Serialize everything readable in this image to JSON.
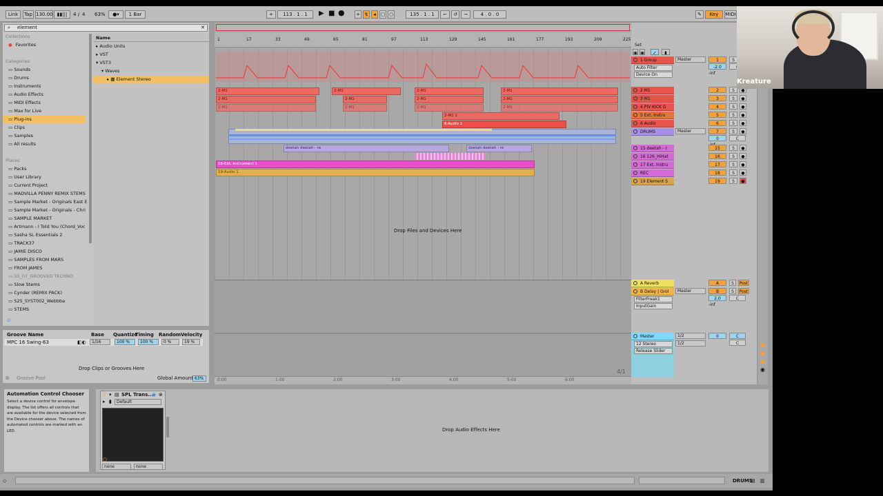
{
  "transport": {
    "link": "Link",
    "tap": "Tap",
    "tempo": "130.00",
    "metronome_icon": "bars-icon",
    "signature_num": "4",
    "signature_den": "4",
    "cpu": "63%",
    "bar_quant": "1 Bar",
    "position": "113 .   1 .   1",
    "loop_start": "135 .   1 .   1",
    "loop_length": "4 .   0 .   0",
    "key": "Key",
    "midi": "MIDI"
  },
  "browser": {
    "search_value": "element",
    "collections_label": "Collections",
    "favorites": "Favorites",
    "categories_label": "Categories",
    "categories": [
      "Sounds",
      "Drums",
      "Instruments",
      "Audio Effects",
      "MIDI Effects",
      "Max for Live",
      "Plug-ins",
      "Clips",
      "Samples",
      "All results"
    ],
    "places_label": "Places",
    "places": [
      "Packs",
      "User Library",
      "Current Project",
      "MADVILLA PENNY REMIX STEMS",
      "Sample Market - Originals East E",
      "Sample Market - Originals - Chri",
      "SAMPLE MARKET",
      "Artmann - I Told You (Chord_Voc",
      "Sasha SL Essentials 2",
      "TRACK37",
      "JAMIE DISCO",
      "SAMPLES FROM MARS",
      "FROM JAMES",
      "SS_07_GROOVED TECHNO",
      "Slow Stems",
      "Cynder (REMIX PACK)",
      "S2S_SYST002_Webbba",
      "STEMS"
    ],
    "name_header": "Name",
    "tree": [
      "Audio Units",
      "VST",
      "VST3",
      "Waves",
      "Element Stereo"
    ]
  },
  "groove": {
    "headers": [
      "Groove Name",
      "Base",
      "Quantize",
      "Timing",
      "Random",
      "Velocity"
    ],
    "row": [
      "MPC 16 Swing-63",
      "1/16",
      "100 %",
      "100 %",
      "0 %",
      "19 %"
    ],
    "drop_text": "Drop Clips or Grooves Here",
    "pool_label": "Groove Pool",
    "global_amount_label": "Global Amount",
    "global_amount": "63%"
  },
  "arrangement": {
    "ruler": [
      "1",
      "17",
      "33",
      "49",
      "65",
      "81",
      "97",
      "113",
      "129",
      "145",
      "161",
      "177",
      "193",
      "209",
      "225"
    ],
    "drop_files": "Drop Files and Devices Here",
    "time_ruler": [
      "0:00",
      "1:00",
      "2:00",
      "3:00",
      "4:00",
      "5:00",
      "6:00"
    ],
    "fraction": "4/1",
    "set_label": "Set",
    "clip_midi": "2-M1",
    "clip_audio6": "6-Audio 1",
    "clip_deetah": "deetah deetah - re",
    "clip_ext": "18-Ext. Instrument 1",
    "clip_audio19": "19-Audio 1",
    "clip_small": "2-M1 2"
  },
  "tracks": [
    {
      "name": "1 Group",
      "sub": "Auto Filter",
      "sub2": "Device On",
      "output": "Master",
      "num": "1",
      "vol": "-2.0",
      "color": "#e8534a"
    },
    {
      "name": "2 M1",
      "num": "2",
      "color": "#e8534a"
    },
    {
      "name": "3 M1",
      "num": "3",
      "color": "#e8534a"
    },
    {
      "name": "4 PIV KICK G",
      "num": "4",
      "color": "#e8534a"
    },
    {
      "name": "5 Ext. Instru",
      "num": "5",
      "color": "#ee7038"
    },
    {
      "name": "6 Audio",
      "num": "6",
      "color": "#e8534a"
    },
    {
      "name": "DRUMS",
      "output": "Master",
      "num": "7",
      "vol": "0",
      "color": "#a890e8"
    },
    {
      "name": "15 deetah - r",
      "num": "15",
      "color": "#d46ad6"
    },
    {
      "name": "16 126_HiHat",
      "num": "16",
      "color": "#d46ad6"
    },
    {
      "name": "17 Ext. Instru",
      "num": "17",
      "color": "#d46ad6"
    },
    {
      "name": "REC",
      "num": "18",
      "color": "#d46ad6"
    },
    {
      "name": "19 Element S",
      "num": "19",
      "color": "#d8a34a"
    }
  ],
  "returns": [
    {
      "name": "A Reverb",
      "num": "A",
      "color": "#f0e060"
    },
    {
      "name": "B Delay | Grol",
      "sub": "FilterFreak1",
      "sub2": "InputGain",
      "output": "Master",
      "num": "B",
      "vol": "2.0",
      "color": "#f2b640"
    }
  ],
  "master": {
    "name": "Master",
    "sub": "12 Stereo",
    "sub2": "Release Slider",
    "input": "1/2",
    "output": "1/2",
    "vol": "0",
    "color": "#7fd8ff"
  },
  "mixer_labels": {
    "solo": "S",
    "post": "Post",
    "inf": "-inf",
    "c": "C"
  },
  "info": {
    "title": "Automation Control Chooser",
    "body": "Select a device control for envelope display. The list offers all controls that are available for the device selected from the Device chooser above. The names of automated controls are marked with an LED."
  },
  "device": {
    "name": "SPL Trans...",
    "preset": "Default",
    "none1": "none",
    "none2": "none",
    "drop_text": "Drop Audio Effects Here"
  },
  "status": {
    "track": "DRUMS"
  },
  "webcam": {
    "label": "Kreature"
  }
}
